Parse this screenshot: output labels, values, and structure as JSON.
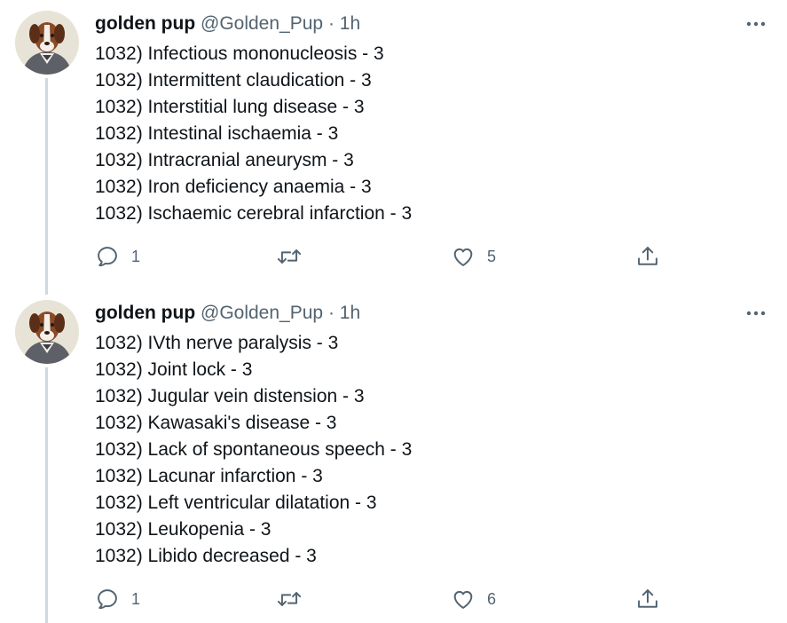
{
  "colors": {
    "text": "#0f1419",
    "muted": "#536471",
    "thread_line": "#cfd9de"
  },
  "icons": {
    "reply": "speech-bubble-outline",
    "retweet": "retweet-arrows",
    "like": "heart-outline",
    "share": "upload-arrow",
    "more": "three-dots-horizontal"
  },
  "tweets": [
    {
      "author_name": "golden pup",
      "handle": "@Golden_Pup",
      "separator": "·",
      "time": "1h",
      "lines": [
        "1032) Infectious mononucleosis - 3",
        "1032) Intermittent claudication - 3",
        "1032) Interstitial lung disease - 3",
        "1032) Intestinal ischaemia - 3",
        "1032) Intracranial aneurysm - 3",
        "1032) Iron deficiency anaemia - 3",
        "1032) Ischaemic cerebral infarction - 3"
      ],
      "reply_count": "1",
      "like_count": "5"
    },
    {
      "author_name": "golden pup",
      "handle": "@Golden_Pup",
      "separator": "·",
      "time": "1h",
      "lines": [
        "1032) IVth nerve paralysis - 3",
        "1032) Joint lock - 3",
        "1032) Jugular vein distension - 3",
        "1032) Kawasaki's disease - 3",
        "1032) Lack of spontaneous speech - 3",
        "1032) Lacunar infarction - 3",
        "1032) Left ventricular dilatation - 3",
        "1032) Leukopenia - 3",
        "1032) Libido decreased - 3"
      ],
      "reply_count": "1",
      "like_count": "6"
    }
  ]
}
